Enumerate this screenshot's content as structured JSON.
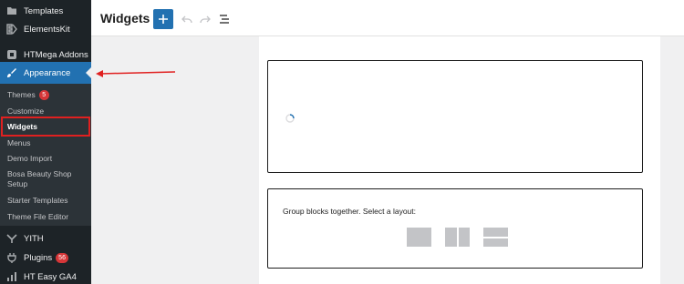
{
  "sidebar": {
    "items": [
      {
        "label": "Templates",
        "icon": "templates-icon"
      },
      {
        "label": "ElementsKit",
        "icon": "elementskit-icon"
      },
      {
        "label": "HTMega Addons",
        "icon": "htmega-icon"
      },
      {
        "label": "Appearance",
        "icon": "paintbrush-icon"
      },
      {
        "label": "YITH",
        "icon": "yith-icon"
      },
      {
        "label": "Plugins",
        "icon": "plugin-icon",
        "badge": "56"
      },
      {
        "label": "HT Easy GA4",
        "icon": "analytics-icon"
      }
    ],
    "submenu": [
      {
        "label": "Themes",
        "badge": "5"
      },
      {
        "label": "Customize"
      },
      {
        "label": "Widgets"
      },
      {
        "label": "Menus"
      },
      {
        "label": "Demo Import"
      },
      {
        "label": "Bosa Beauty Shop Setup"
      },
      {
        "label": "Starter Templates"
      },
      {
        "label": "Theme File Editor"
      }
    ]
  },
  "header": {
    "title": "Widgets",
    "add_icon": "plus-icon",
    "undo_icon": "undo-icon",
    "redo_icon": "redo-icon",
    "list_view_icon": "list-view-icon"
  },
  "editor": {
    "group_prompt": "Group blocks together. Select a layout:"
  },
  "colors": {
    "sidebar_bg": "#1d2327",
    "submenu_bg": "#2c3338",
    "accent": "#2271b1",
    "badge": "#d63638",
    "annotation": "#e02020"
  }
}
